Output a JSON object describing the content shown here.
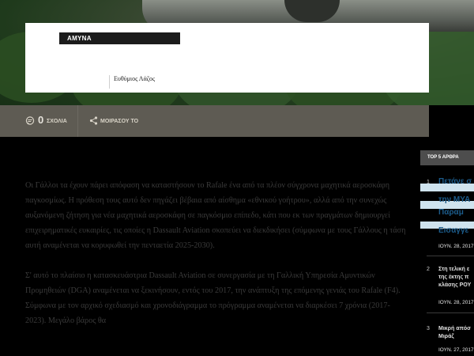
{
  "header": {
    "category": "ΑΜΥΝΑ",
    "author": "Ευθύμιος Λάζος"
  },
  "social": {
    "comments_count": "0",
    "comments_label": "ΣΧΟΛΙΑ",
    "share_label": "ΜΟΙΡΑΣΟΥ ΤΟ"
  },
  "article": {
    "paragraphs": [
      "Οι Γάλλοι τα έχουν πάρει απόφαση να καταστήσουν το Rafale ένα από τα πλέον σύγχρονα μαχητικά αεροσκάφη παγκοσμίως. Η πρόθεση τους αυτό δεν πηγάζει βέβαια από αίσθημα «εθνικού γοήτρου», αλλά από την συνεχώς αυξανόμενη ζήτηση για νέα μαχητικά αεροσκάφη σε παγκόσμιο επίπεδο, κάτι που εκ των πραγμάτων δημιουργεί επιχειρηματικές ευκαιρίες, τις οποίες η Dassault Aviation σκοπεύει να διεκδικήσει (σύμφωνα με τους Γάλλους η τάση αυτή αναμένεται να κορυφωθεί την πενταετία 2025-2030).",
      "Σ' αυτό το πλαίσιο η κατασκευάστρια Dassault Aviation σε συνεργασία με τη Γαλλική Υπηρεσία Αμυντικών Προμηθειών (DGA) αναμένεται να ξεκινήσουν, εντός του 2017, την ανάπτυξη της επόμενης γενιάς του Rafale (F4). Σύμφωνα με τον αρχικό σχεδιασμό και χρονοδιάγραμμα το πρόγραμμα αναμένεται να διαρκέσει 7 χρόνια (2017-2023). Μεγάλο βάρος θα"
    ]
  },
  "sidebar": {
    "heading": "TOP 5 ΑΡΘΡΑ",
    "items": [
      {
        "rank": "1",
        "title_lines": [
          "Πετάνε σ",
          "την ΜΥΑ",
          "Παραμ",
          "Εισαγγε"
        ],
        "date": "ΙΟΥΝ. 28, 2017"
      },
      {
        "rank": "2",
        "title_lines": [
          "Στη τελική ε",
          "της έκτης π",
          "κλάσης ΡΟΥ"
        ],
        "date": "ΙΟΥΝ. 28, 2017"
      },
      {
        "rank": "3",
        "title_lines": [
          "Μικρή απόσ",
          "Μιράζ"
        ],
        "date": "ΙΟΥΝ. 27, 2017"
      }
    ]
  },
  "colors": {
    "bar": "#5e5b53",
    "card": "#ffffff",
    "category_bg": "#1c1c1c",
    "sidebar_head": "#4d4d4d",
    "sidebar_link": "#1c5b8a",
    "highlight": "#cfe3ee"
  }
}
